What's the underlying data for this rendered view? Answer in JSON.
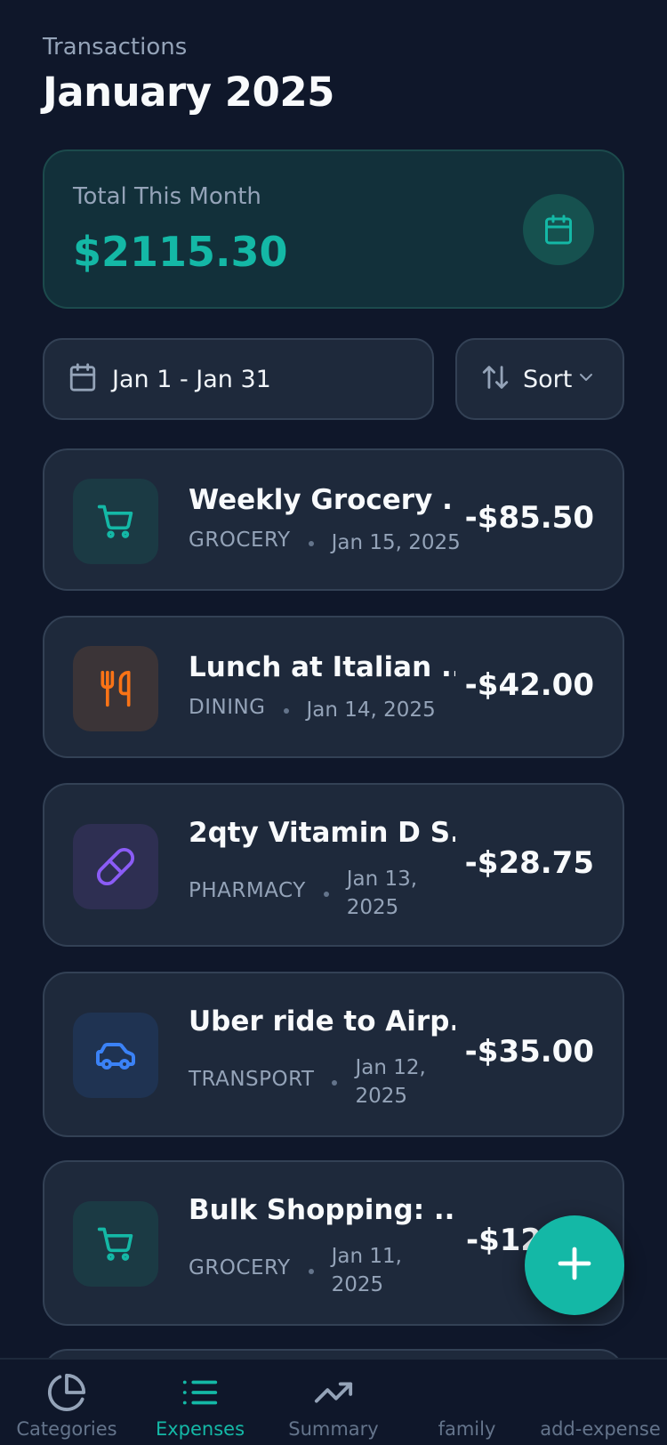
{
  "header": {
    "subtitle": "Transactions",
    "title": "January 2025"
  },
  "summary": {
    "label": "Total This Month",
    "amount": "$2115.30",
    "icon": "calendar-icon"
  },
  "filters": {
    "date_range": "Jan 1 - Jan 31",
    "sort_label": "Sort"
  },
  "transactions": [
    {
      "title": "Weekly Grocery ...",
      "category": "GROCERY",
      "date": "Jan 15, 2025",
      "amount": "-$85.50",
      "icon": "cart-icon",
      "icon_color": "#14b8a6",
      "icon_bg": "#1b3a44"
    },
    {
      "title": "Lunch at Italian ...",
      "category": "DINING",
      "date": "Jan 14, 2025",
      "amount": "-$42.00",
      "icon": "utensils-icon",
      "icon_color": "#f97316",
      "icon_bg": "#3b3437"
    },
    {
      "title": "2qty Vitamin D S...",
      "category": "PHARMACY",
      "date": "Jan 13, 2025",
      "amount": "-$28.75",
      "icon": "pill-icon",
      "icon_color": "#8b5cf6",
      "icon_bg": "#2e2f52"
    },
    {
      "title": "Uber ride to Airp...",
      "category": "TRANSPORT",
      "date": "Jan 12, 2025",
      "amount": "-$35.00",
      "icon": "car-icon",
      "icon_color": "#3b82f6",
      "icon_bg": "#1f3352"
    },
    {
      "title": "Bulk Shopping: ...",
      "category": "GROCERY",
      "date": "Jan 11, 2025",
      "amount": "-$12",
      "icon": "cart-icon",
      "icon_color": "#14b8a6",
      "icon_bg": "#1b3a44"
    }
  ],
  "tabs": [
    {
      "label": "Categories",
      "icon": "pie-chart-icon",
      "active": false
    },
    {
      "label": "Expenses",
      "icon": "list-icon",
      "active": true
    },
    {
      "label": "Summary",
      "icon": "trending-up-icon",
      "active": false
    },
    {
      "label": "family",
      "icon": "",
      "active": false
    },
    {
      "label": "add-expense",
      "icon": "",
      "active": false
    }
  ],
  "colors": {
    "accent": "#14b8a6",
    "background": "#0f172a",
    "card": "#1e293b"
  }
}
